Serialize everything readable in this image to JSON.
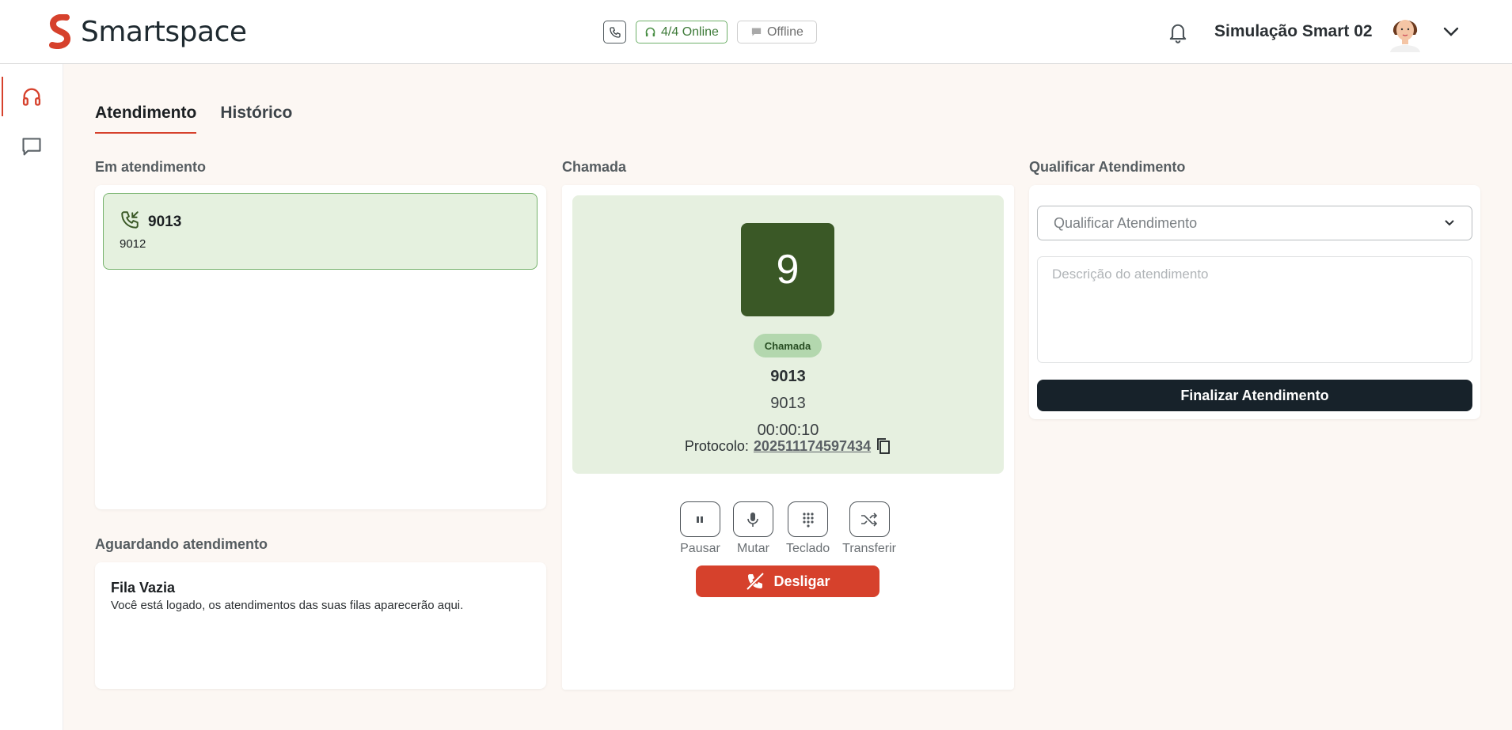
{
  "app": {
    "name": "Smartspace"
  },
  "header": {
    "online_status": "4/4 Online",
    "chat_status": "Offline",
    "user_name": "Simulação Smart 02"
  },
  "tabs": [
    {
      "label": "Atendimento",
      "active": true
    },
    {
      "label": "Histórico",
      "active": false
    }
  ],
  "em_atendimento": {
    "title": "Em atendimento",
    "items": [
      {
        "number": "9013",
        "sub": "9012",
        "icon": "incoming-call-icon"
      }
    ]
  },
  "aguardando": {
    "title": "Aguardando atendimento",
    "empty_title": "Fila Vazia",
    "empty_message": "Você está logado, os atendimentos das suas filas aparecerão aqui."
  },
  "chamada": {
    "title": "Chamada",
    "avatar_letter": "9",
    "badge": "Chamada",
    "name": "9013",
    "number": "9013",
    "duration": "00:00:10",
    "protocol_label": "Protocolo:",
    "protocol_value": "202511174597434",
    "controls": [
      {
        "label": "Pausar",
        "icon": "pause-icon"
      },
      {
        "label": "Mutar",
        "icon": "microphone-icon"
      },
      {
        "label": "Teclado",
        "icon": "keypad-icon"
      },
      {
        "label": "Transferir",
        "icon": "transfer-icon"
      }
    ],
    "hangup_label": "Desligar"
  },
  "qualificar": {
    "title": "Qualificar Atendimento",
    "select_placeholder": "Qualificar Atendimento",
    "description_placeholder": "Descrição do atendimento",
    "submit_label": "Finalizar Atendimento"
  },
  "colors": {
    "accent": "#d6412c",
    "call_green": "#3a5826",
    "panel_green": "#e6f0e0",
    "dark": "#17222a"
  }
}
